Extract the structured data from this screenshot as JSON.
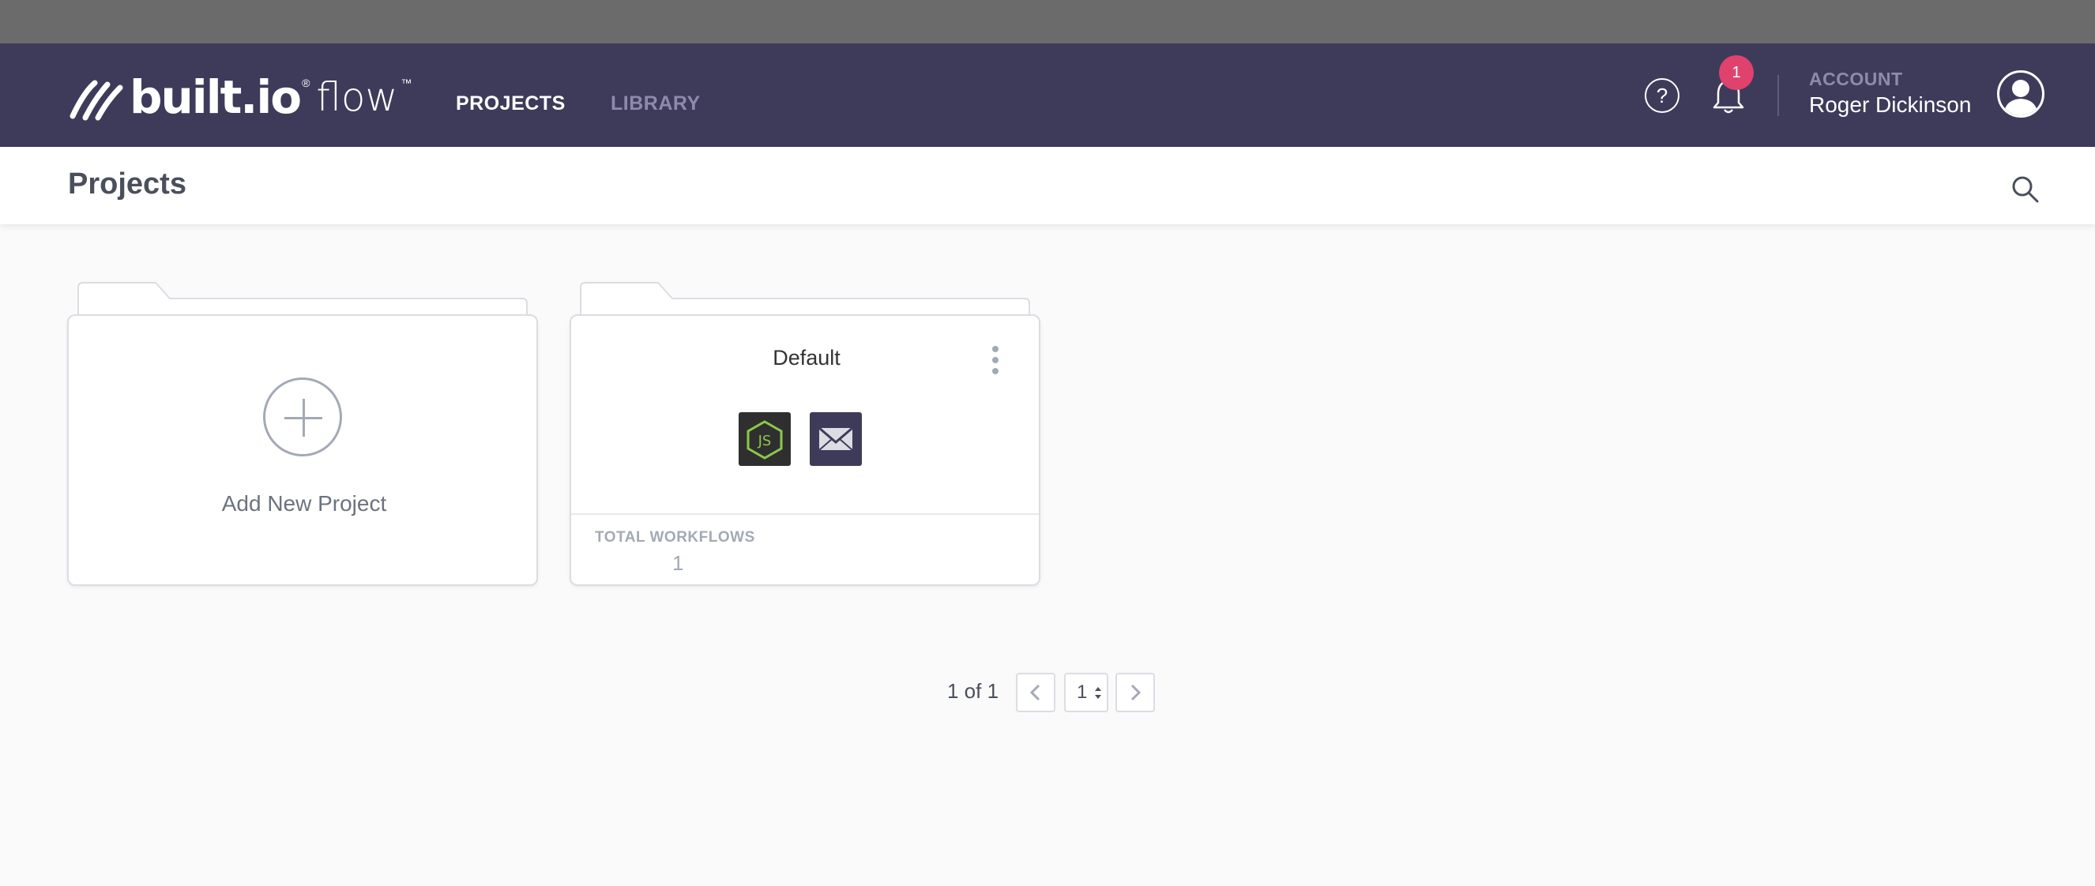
{
  "header": {
    "logo_text": "built.io",
    "logo_reg": "®",
    "logo_product": "flow",
    "logo_tm": "™",
    "nav": [
      {
        "label": "PROJECTS",
        "active": true
      },
      {
        "label": "LIBRARY",
        "active": false
      }
    ],
    "help_glyph": "?",
    "notification_count": "1",
    "account_label": "ACCOUNT",
    "account_name": "Roger Dickinson"
  },
  "subheader": {
    "title": "Projects"
  },
  "cards": {
    "add": {
      "label": "Add New Project"
    },
    "projects": [
      {
        "name": "Default",
        "services": [
          "nodejs-icon",
          "email-icon"
        ],
        "workflows_label": "TOTAL WORKFLOWS",
        "workflows_count": "1"
      }
    ]
  },
  "pagination": {
    "summary": "1 of 1",
    "current_page": "1"
  },
  "colors": {
    "nav_bg": "#3e3b5a",
    "badge": "#e0426e",
    "nodejs_green": "#8cc84b"
  }
}
